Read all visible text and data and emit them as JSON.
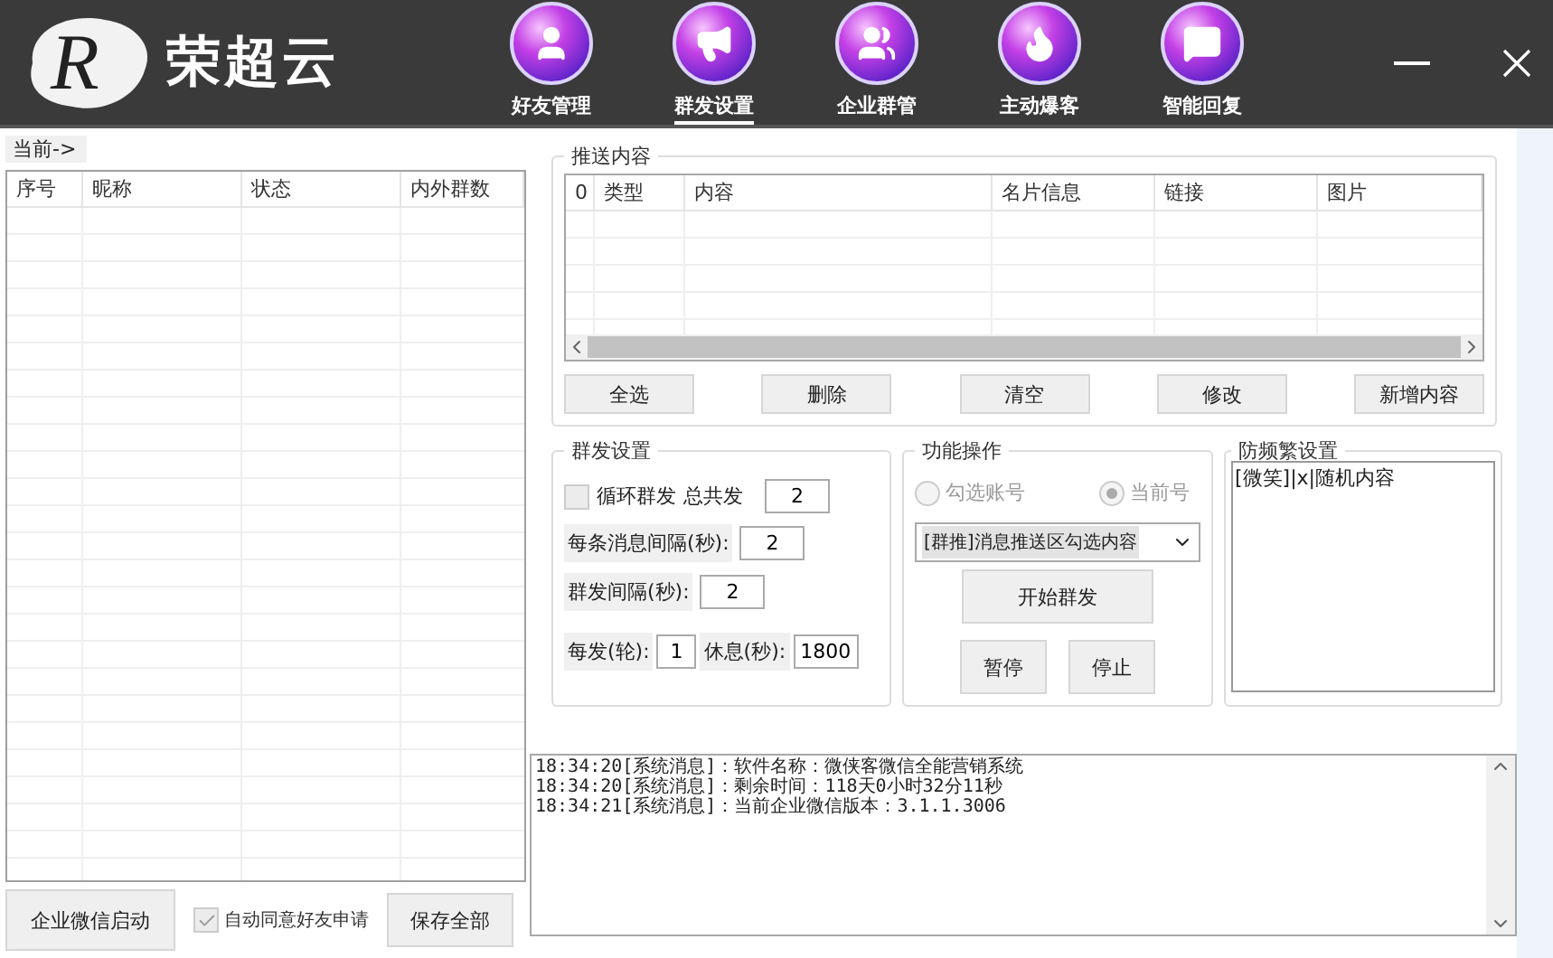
{
  "app": {
    "logo_letter": "R",
    "title": "荣超云"
  },
  "nav": [
    {
      "label": "好友管理",
      "kind": "user",
      "selected": false
    },
    {
      "label": "群发设置",
      "kind": "megaphone",
      "selected": true
    },
    {
      "label": "企业群管",
      "kind": "users",
      "selected": false
    },
    {
      "label": "主动爆客",
      "kind": "flame",
      "selected": false
    },
    {
      "label": "智能回复",
      "kind": "message",
      "selected": false
    }
  ],
  "current_label": "当前->",
  "accounts_table": {
    "columns": [
      "序号",
      "昵称",
      "状态",
      "内外群数"
    ]
  },
  "push_content": {
    "title": "推送内容",
    "columns": [
      "0",
      "类型",
      "内容",
      "名片信息",
      "链接",
      "图片"
    ],
    "buttons": [
      "全选",
      "删除",
      "清空",
      "修改",
      "新增内容"
    ]
  },
  "group_settings": {
    "title": "群发设置",
    "loop": {
      "label": "循环群发",
      "checked": false
    },
    "total_label": "总共发",
    "total": "2",
    "interval_label": "每条消息间隔(秒):",
    "interval": "2",
    "group_interval_label": "群发间隔(秒):",
    "group_interval": "2",
    "per_round_label": "每发(轮):",
    "per_round": "1",
    "rest_label": "休息(秒):",
    "rest": "1800"
  },
  "operations": {
    "title": "功能操作",
    "radios": [
      {
        "label": "勾选账号",
        "selected": false,
        "disabled": true
      },
      {
        "label": "当前号",
        "selected": true,
        "disabled": true
      }
    ],
    "dropdown": "[群推]消息推送区勾选内容",
    "start_button": "开始群发",
    "pause_button": "暂停",
    "stop_button": "停止"
  },
  "anti_spam": {
    "title": "防频繁设置",
    "value": "[微笑]|x|随机内容"
  },
  "log": [
    "18:34:20[系统消息]：软件名称：微侠客微信全能营销系统",
    "18:34:20[系统消息]：剩余时间：118天0小时32分11秒",
    "18:34:21[系统消息]：当前企业微信版本：3.1.1.3006"
  ],
  "footer": {
    "start_button": "企业微信启动",
    "auto_accept": {
      "label": "自动同意好友申请",
      "checked": true,
      "disabled": true
    },
    "save_button": "保存全部"
  }
}
